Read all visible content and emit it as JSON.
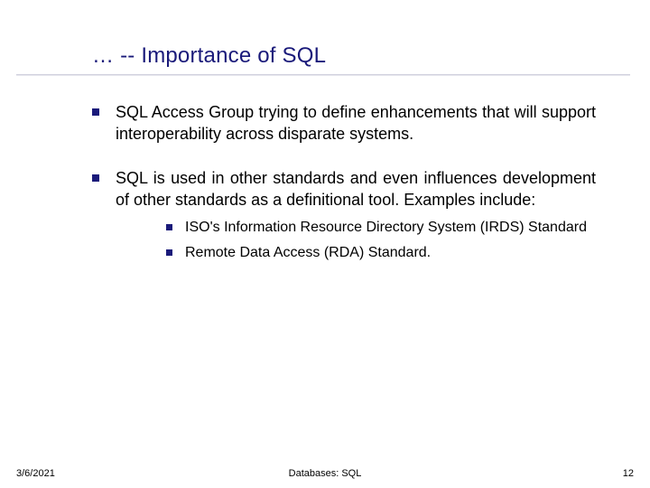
{
  "title": "… -- Importance of SQL",
  "bullets": [
    {
      "text": "SQL Access Group trying to define enhancements that will support interoperability across disparate systems."
    },
    {
      "text": "SQL is used in other standards and even influences development of other standards as a definitional tool. Examples include:",
      "sub": [
        "ISO's Information Resource Directory System (IRDS) Standard",
        "Remote Data Access (RDA) Standard."
      ]
    }
  ],
  "footer": {
    "date": "3/6/2021",
    "center": "Databases: SQL",
    "page": "12"
  }
}
